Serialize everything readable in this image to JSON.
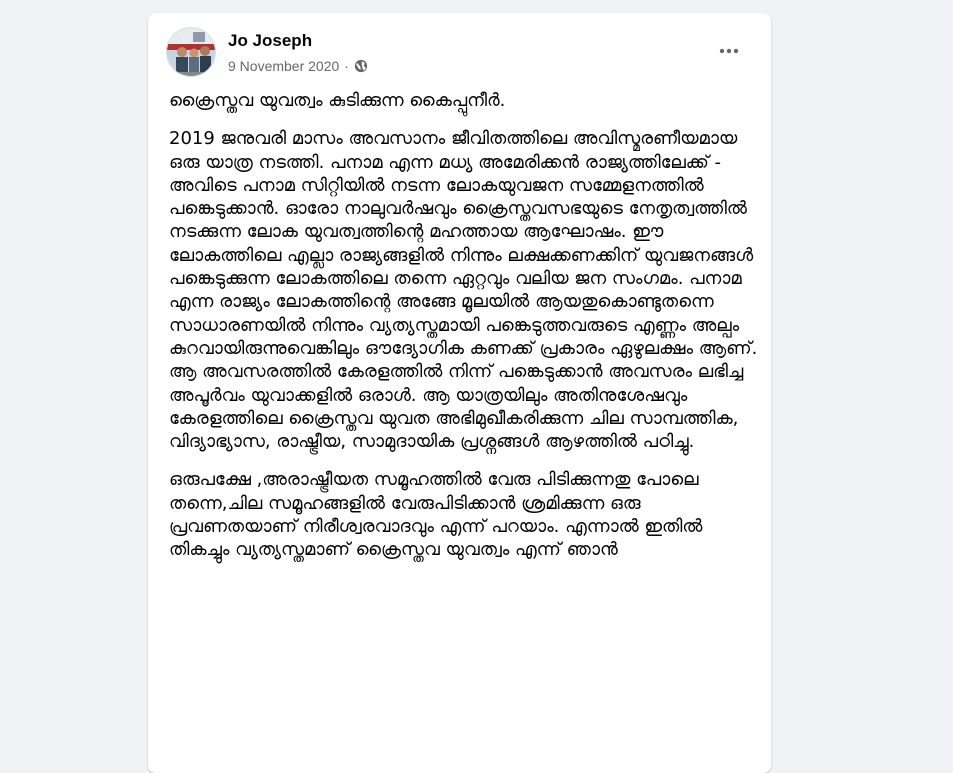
{
  "post": {
    "author_name": "Jo Joseph",
    "date": "9 November 2020",
    "separator": "·",
    "privacy_icon": "globe-icon",
    "menu_icon": "more-options-icon",
    "paragraphs": [
      "ക്രൈസ്തവ യുവത്വം കുടിക്കുന്ന കൈപ്പുനീർ.",
      "2019 ജനുവരി മാസം അവസാനം ജീവിതത്തിലെ അവിസ്മരണീയമായ ഒരു യാത്ര നടത്തി. പനാമ എന്ന മധ്യ അമേരിക്കൻ രാജ്യത്തിലേക്ക് - അവിടെ പനാമ സിറ്റിയിൽ നടന്ന ലോകയുവജന സമ്മേളനത്തിൽ പങ്കെടുക്കാൻ. ഓരോ നാലുവർഷവും ക്രൈസ്തവസഭയുടെ നേതൃത്വത്തിൽ നടക്കുന്ന ലോക യുവത്വത്തിന്റെ മഹത്തായ ആഘോഷം. ഈ ലോകത്തിലെ എല്ലാ രാജ്യങ്ങളിൽ നിന്നും ലക്ഷക്കണക്കിന് യുവജനങ്ങൾ പങ്കെടുക്കുന്ന ലോകത്തിലെ തന്നെ ഏറ്റവും വലിയ ജന സംഗമം. പനാമ എന്ന രാജ്യം ലോകത്തിന്റെ അങ്ങേ മൂലയിൽ ആയതുകൊണ്ടുതന്നെ സാധാരണയിൽ നിന്നും വ്യത്യസ്തമായി പങ്കെടുത്തവരുടെ എണ്ണം അല്പം കുറവായിരുന്നുവെങ്കിലും ഔദ്യോഗിക കണക്ക് പ്രകാരം ഏഴുലക്ഷം ആണ്. ആ അവസരത്തിൽ കേരളത്തിൽ നിന്ന് പങ്കെടുക്കാൻ അവസരം ലഭിച്ച അപൂർവം യുവാക്കളിൽ ഒരാൾ. ആ യാത്രയിലും അതിനുശേഷവും കേരളത്തിലെ ക്രൈസ്തവ യുവത അഭിമുഖീകരിക്കുന്ന ചില സാമ്പത്തിക, വിദ്യാഭ്യാസ, രാഷ്ട്രീയ, സാമുദായിക പ്രശ്നങ്ങൾ ആഴത്തിൽ പഠിച്ചു.",
      "ഒരുപക്ഷേ ,അരാഷ്ട്രീയത സമൂഹത്തിൽ വേരു പിടിക്കുന്നതു പോലെ തന്നെ,ചില സമൂഹങ്ങളിൽ വേരുപിടിക്കാൻ ശ്രമിക്കുന്ന ഒരു പ്രവണതയാണ് നിരീശ്വരവാദവും എന്ന് പറയാം. എന്നാൽ ഇതിൽ തികച്ചും വ്യത്യസ്തമാണ് ക്രൈസ്തവ യുവത്വം എന്ന് ഞാൻ"
    ]
  },
  "colors": {
    "page_bg": "#f0f2f5",
    "card_bg": "#ffffff",
    "text_primary": "#050505",
    "text_secondary": "#65676b"
  }
}
